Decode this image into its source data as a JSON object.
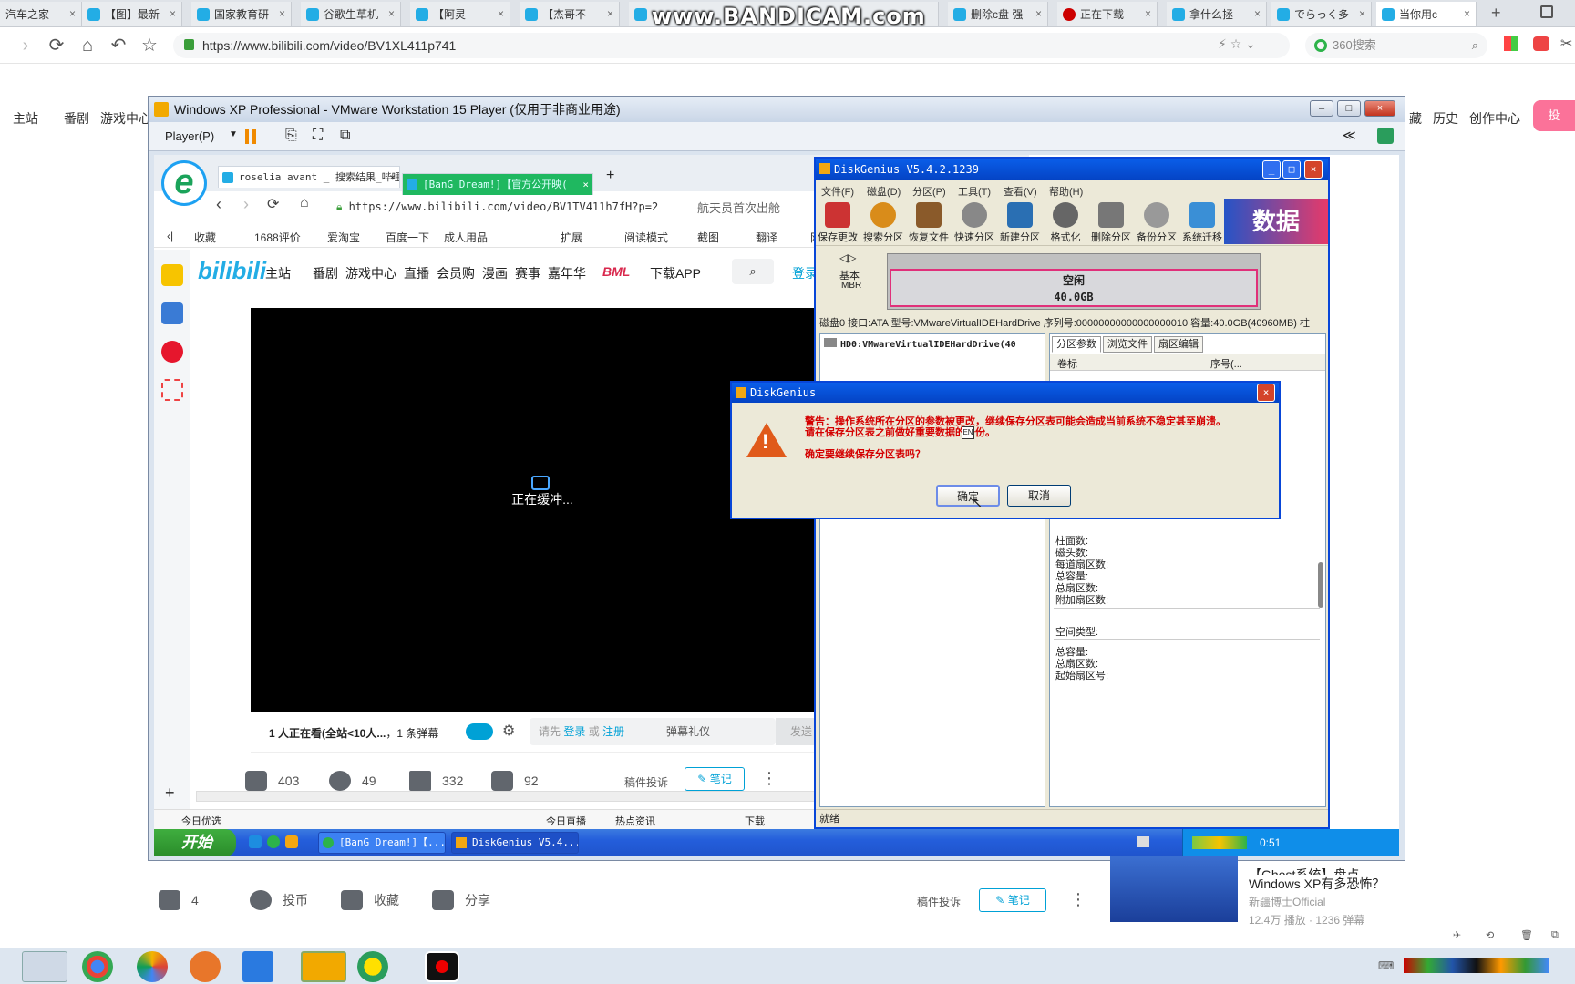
{
  "outer_tabs": [
    {
      "label": "汽车之家"
    },
    {
      "label": "【图】最新"
    },
    {
      "label": "国家教育研"
    },
    {
      "label": "谷歌生草机"
    },
    {
      "label": "【阿灵"
    },
    {
      "label": "【杰哥不"
    },
    {
      "label": ""
    },
    {
      "label": "删除c盘 强"
    },
    {
      "label": "正在下载 "
    },
    {
      "label": "拿什么拯"
    },
    {
      "label": "でらっく多"
    },
    {
      "label": "当你用c"
    }
  ],
  "watermark": "www.BANDICAM.com",
  "outer_url": "https://www.bilibili.com/video/BV1XL411p741",
  "outer_search": "360搜索",
  "bili_outer_nav": [
    "主站",
    "番剧",
    "游戏中心"
  ],
  "bili_outer_right": [
    "藏",
    "历史",
    "创作中心"
  ],
  "bili_outer_login": "投",
  "vm": {
    "title": "Windows XP Professional - VMware Workstation 15 Player (仅用于非商业用途)",
    "player_menu": "Player(P)",
    "collapse": "≪"
  },
  "ie": {
    "tabs": [
      "roselia avant _ 搜索结果_哔哩",
      "[BanG Dream!]【官方公开映("
    ],
    "url": "https://www.bilibili.com/video/BV1TV411h7fH?p=2",
    "search_hint": "航天员首次出舱",
    "favorites": [
      "收藏",
      "1688评价",
      "爱淘宝",
      "百度一下",
      "成人用品",
      "扩展",
      "阅读模式",
      "截图",
      "翻译",
      "网银"
    ],
    "bili_nav": [
      "主站",
      "番剧",
      "游戏中心",
      "直播",
      "会员购",
      "漫画",
      "赛事",
      "嘉年华",
      "BML",
      "下载APP",
      "登录"
    ],
    "buffering": "正在缓冲...",
    "danmaku": {
      "watching": "1 人正在看(全站<10人...",
      "count": "，1 条弹幕",
      "placeholder_pre": "请先",
      "login": "登录",
      "or": "或",
      "register": "注册",
      "etiquette": "弹幕礼仪",
      "send": "发送"
    },
    "actions": [
      {
        "label": "403"
      },
      {
        "label": "49"
      },
      {
        "label": "332"
      },
      {
        "label": "92"
      }
    ],
    "report": "稿件投诉",
    "note": "笔记",
    "status": [
      "今日优选",
      "今日直播",
      "热点资讯",
      "下载"
    ]
  },
  "xp": {
    "start": "开始",
    "tasks": [
      "[BanG Dream!]【...",
      "DiskGenius V5.4...."
    ],
    "clock": "0:51"
  },
  "dg": {
    "title": "DiskGenius V5.4.2.1239",
    "menu": [
      "文件(F)",
      "磁盘(D)",
      "分区(P)",
      "工具(T)",
      "查看(V)",
      "帮助(H)"
    ],
    "tools": [
      "保存更改",
      "搜索分区",
      "恢复文件",
      "快速分区",
      "新建分区",
      "格式化",
      "删除分区",
      "备份分区",
      "系统迁移"
    ],
    "disk_type": "基本",
    "disk_mbr": "MBR",
    "free_label": "空闲",
    "free_size": "40.0GB",
    "info": "磁盘0 接口:ATA  型号:VMwareVirtualIDEHardDrive  序列号:00000000000000000010  容量:40.0GB(40960MB)  柱",
    "tree_item": "HD0:VMwareVirtualIDEHardDrive(40",
    "right_tabs": [
      "分区参数",
      "浏览文件",
      "扇区编辑"
    ],
    "cols": [
      "卷标",
      "序号(..."
    ],
    "params": [
      "柱面数:",
      "磁头数:",
      "每道扇区数:",
      "总容量:",
      "总扇区数:",
      "附加扇区数:"
    ],
    "space_type": "空间类型:",
    "params2": [
      "总容量:",
      "总扇区数:",
      "起始扇区号:"
    ],
    "status": "就绪",
    "brand": "数据"
  },
  "dialog": {
    "title": "DiskGenius",
    "line1": "警告：操作系统所在分区的参数被更改，继续保存分区表可能会造成当前系统不稳定甚至崩溃。",
    "line2": "请在保存分区表之前做好重要数据的备份。",
    "line3": "确定要继续保存分区表吗？",
    "ok": "确定",
    "cancel": "取消",
    "ime": "EN"
  },
  "page_below": {
    "actions": [
      "4",
      "投币",
      "收藏",
      "分享"
    ],
    "report": "稿件投诉",
    "note": "笔记",
    "side_title": "【Ghost系统】盘点",
    "side_title2": "Windows XP有多恐怖？",
    "side_author": "新疆博士Official",
    "side_stats": "12.4万 播放 · 1236 弹幕"
  }
}
